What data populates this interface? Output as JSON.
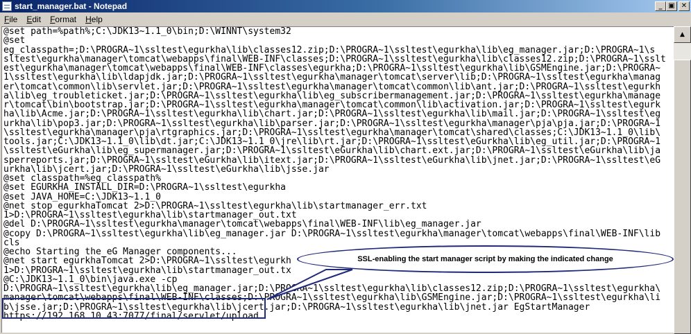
{
  "window": {
    "title": "start_manager.bat - Notepad",
    "controls": {
      "minimize": "_",
      "maximize": "▣",
      "close": "✕"
    }
  },
  "menu": [
    {
      "mnemonic": "F",
      "rest": "ile"
    },
    {
      "mnemonic": "E",
      "rest": "dit"
    },
    {
      "mnemonic": "F",
      "rest": "ormat"
    },
    {
      "mnemonic": "H",
      "rest": "elp"
    }
  ],
  "editor": {
    "lines": [
      "@set path=%path%;C:\\JDK13~1.1_0\\bin;D:\\WINNT\\system32",
      "@set",
      "eg_classpath=;D:\\PROGRA~1\\ssltest\\egurkha\\lib\\classes12.zip;D:\\PROGRA~1\\ssltest\\egurkha\\lib\\eg_manager.jar;D:\\PROGRA~1\\s",
      "sltest\\egurkha\\manager\\tomcat\\webapps\\final\\WEB-INF\\classes;D:\\PROGRA~1\\ssltest\\egurkha\\lib\\classes12.zip;D:\\PROGRA~1\\sslt",
      "est\\egurkha\\manager\\tomcat\\webapps\\final\\WEB-INF\\classes\\egurkha;D:\\PROGRA~1\\ssltest\\egurkha\\lib\\GSMEngine.jar;D:\\PROGRA~",
      "1\\ssltest\\egurkha\\lib\\ldapjdk.jar;D:\\PROGRA~1\\ssltest\\egurkha\\manager\\tomcat\\server\\lib;D:\\PROGRA~1\\ssltest\\egurkha\\manag",
      "er\\tomcat\\common\\lib\\servlet.jar;D:\\PROGRA~1\\ssltest\\egurkha\\manager\\tomcat\\common\\lib\\ant.jar;D:\\PROGRA~1\\ssltest\\egurkh",
      "a\\lib\\eg_troubleticket.jar;D:\\PROGRA~1\\ssltest\\egurkha\\lib\\eg_subscribermanagement.jar;D:\\PROGRA~1\\ssltest\\egurkha\\manage",
      "r\\tomcat\\bin\\bootstrap.jar;D:\\PROGRA~1\\ssltest\\egurkha\\manager\\tomcat\\common\\lib\\activation.jar;D:\\PROGRA~1\\ssltest\\egurk",
      "ha\\lib\\Acme.jar;D:\\PROGRA~1\\ssltest\\egurkha\\lib\\chart.jar;D:\\PROGRA~1\\ssltest\\egurkha\\lib\\mail.jar;D:\\PROGRA~1\\ssltest\\eg",
      "urkha\\lib\\pop3.jar;D:\\PROGRA~1\\ssltest\\egurkha\\lib\\parser.jar;D:\\PROGRA~1\\ssltest\\egurkha\\manager\\pja\\pja.jar;D:\\PROGRA~1",
      "\\ssltest\\egurkha\\manager\\pja\\rtgraphics.jar;D:\\PROGRA~1\\ssltest\\egurkha\\manager\\tomcat\\shared\\classes;C:\\JDK13~1.1_0\\lib\\",
      "tools.jar;C:\\JDK13~1.1_0\\lib\\dt.jar;C:\\JDK13~1.1_0\\jre\\lib\\rt.jar;D:\\PROGRA~1\\ssltest\\eGurkha\\lib\\eg_util.jar;D:\\PROGRA~1",
      "\\ssltest\\eGurkha\\lib\\eg_supermanager.jar;D:\\PROGRA~1\\ssltest\\eGurkha\\lib\\chart.ext.jar;D:\\PROGRA~1\\ssltest\\eGurkha\\lib\\ja",
      "sperreports.jar;D:\\PROGRA~1\\ssltest\\eGurkha\\lib\\itext.jar;D:\\PROGRA~1\\ssltest\\eGurkha\\lib\\jnet.jar;D:\\PROGRA~1\\ssltest\\eG",
      "urkha\\lib\\jcert.jar;D:\\PROGRA~1\\ssltest\\eGurkha\\lib\\jsse.jar",
      "@set classpath=%eg_classpath%",
      "@set EGURKHA_INSTALL_DIR=D:\\PROGRA~1\\ssltest\\egurkha",
      "@set JAVA_HOME=C:\\JDK13~1.1_0",
      "@net stop egurkhaTomcat 2>D:\\PROGRA~1\\ssltest\\egurkha\\lib\\startmanager_err.txt",
      "1>D:\\PROGRA~1\\ssltest\\egurkha\\lib\\startmanager_out.txt",
      "@del D:\\PROGRA~1\\ssltest\\egurkha\\manager\\tomcat\\webapps\\final\\WEB-INF\\lib\\eg_manager.jar",
      "@copy D:\\PROGRA~1\\ssltest\\egurkha\\lib\\eg_manager.jar D:\\PROGRA~1\\ssltest\\egurkha\\manager\\tomcat\\webapps\\final\\WEB-INF\\lib",
      "cls",
      "@echo Starting the eG Manager components...",
      "@net start egurkhaTomcat 2>D:\\PROGRA~1\\ssltest\\egurkh",
      "1>D:\\PROGRA~1\\ssltest\\egurkha\\lib\\startmanager_out.tx",
      "@C:\\JDK13~1.1_0\\bin\\java.exe -cp",
      "D:\\PROGRA~1\\ssltest\\egurkha\\lib\\eg_manager.jar;D:\\PROGRA~1\\ssltest\\egurkha\\lib\\classes12.zip;D:\\PROGRA~1\\ssltest\\egurkha\\",
      "manager\\tomcat\\webapps\\final\\WEB-INF\\classes;D:\\PROGRA~1\\ssltest\\egurkha\\lib\\GSMEngine.jar;D:\\PROGRA~1\\ssltest\\egurkha\\li",
      "b\\jsse.jar;D:\\PROGRA~1\\ssltest\\egurkha\\lib\\jcert.jar;D:\\PROGRA~1\\ssltest\\egurkha\\lib\\jnet.jar EgStartManager",
      "https://192.168.10.43:7077/final/servlet/upload"
    ]
  },
  "callout": {
    "text": "SSL-enabling the start manager script by making the indicated change"
  },
  "scrollbar": {
    "up_arrow": "▲",
    "down_arrow": "▼"
  },
  "colors": {
    "titlebar_start": "#0a246a",
    "titlebar_end": "#a6caf0",
    "annotation_border": "#1f2a78",
    "chrome": "#d4d0c8"
  }
}
